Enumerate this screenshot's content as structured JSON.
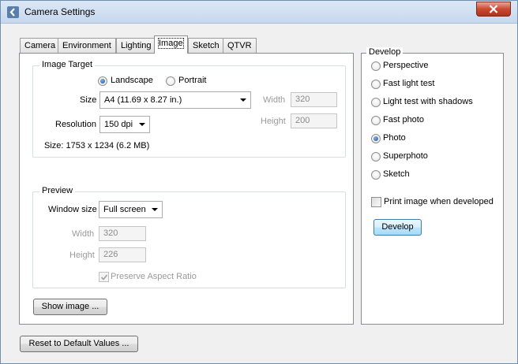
{
  "window": {
    "title": "Camera Settings"
  },
  "tabs": [
    {
      "label": "Camera",
      "active": false
    },
    {
      "label": "Environment",
      "active": false
    },
    {
      "label": "Lighting",
      "active": false
    },
    {
      "label": "Image",
      "active": true
    },
    {
      "label": "Sketch",
      "active": false
    },
    {
      "label": "QTVR",
      "active": false
    }
  ],
  "image_target": {
    "group_title": "Image Target",
    "orientation": {
      "landscape_label": "Landscape",
      "portrait_label": "Portrait",
      "selected": "Landscape"
    },
    "size_label": "Size",
    "size_value": "A4 (11.69 x 8.27 in.)",
    "width_label": "Width",
    "width_value": "320",
    "height_label": "Height",
    "height_value": "200",
    "resolution_label": "Resolution",
    "resolution_value": "150 dpi",
    "size_info": "Size: 1753 x 1234 (6.2 MB)"
  },
  "preview": {
    "group_title": "Preview",
    "window_size_label": "Window size",
    "window_size_value": "Full screen",
    "width_label": "Width",
    "width_value": "320",
    "height_label": "Height",
    "height_value": "226",
    "preserve_aspect_label": "Preserve Aspect Ratio",
    "preserve_aspect_checked": true
  },
  "buttons": {
    "show_image": "Show image ...",
    "reset": "Reset to Default Values ...",
    "develop": "Develop"
  },
  "develop": {
    "group_title": "Develop",
    "options": [
      "Perspective",
      "Fast light test",
      "Light test with shadows",
      "Fast photo",
      "Photo",
      "Superphoto",
      "Sketch"
    ],
    "selected": "Photo",
    "print_label": "Print image when developed",
    "print_checked": false
  },
  "colors": {
    "accent": "#3c7fb1",
    "close_button": "#c94a30"
  }
}
